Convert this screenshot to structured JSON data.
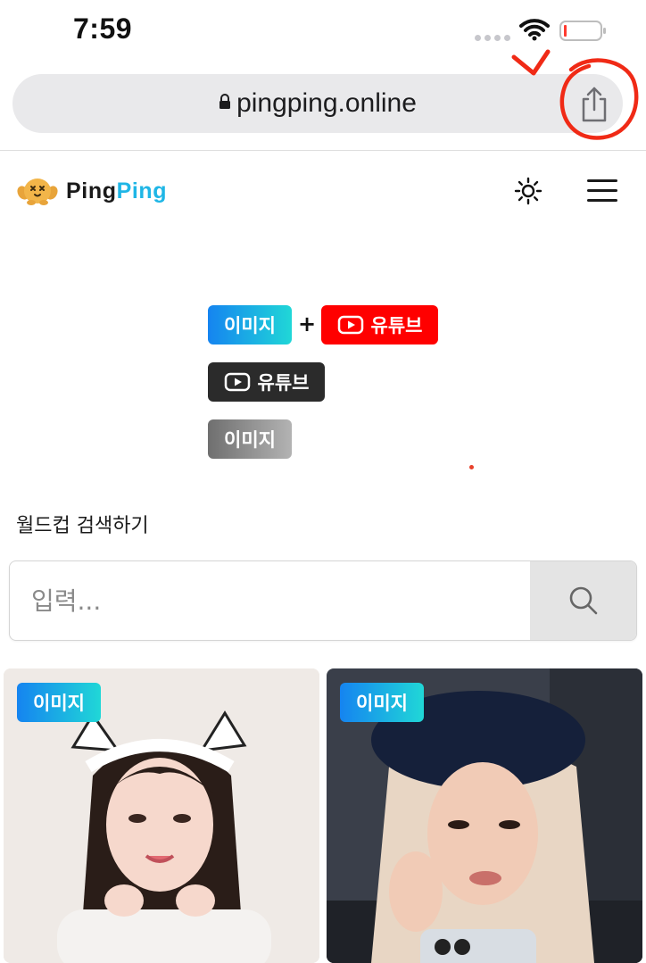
{
  "status_bar": {
    "time": "7:59"
  },
  "browser": {
    "url": "pingping.online"
  },
  "site": {
    "logo_part1": "Ping",
    "logo_part2": "Ping",
    "brand_color": "#1fb6e6"
  },
  "legend": {
    "image_label": "이미지",
    "plus": "+",
    "youtube_label": "유튜브",
    "youtube_only_label": "유튜브",
    "image_only_label": "이미지",
    "colors": {
      "youtube": "#ff0000",
      "image_gradient": [
        "#1584f0",
        "#20d7d7"
      ]
    }
  },
  "search": {
    "title": "월드컵 검색하기",
    "placeholder": "입력..."
  },
  "cards": [
    {
      "badge": "이미지"
    },
    {
      "badge": "이미지"
    }
  ],
  "icons": [
    "lock-icon",
    "share-icon",
    "wifi-icon",
    "battery-icon",
    "sun-icon",
    "menu-icon",
    "search-icon",
    "youtube-icon"
  ]
}
